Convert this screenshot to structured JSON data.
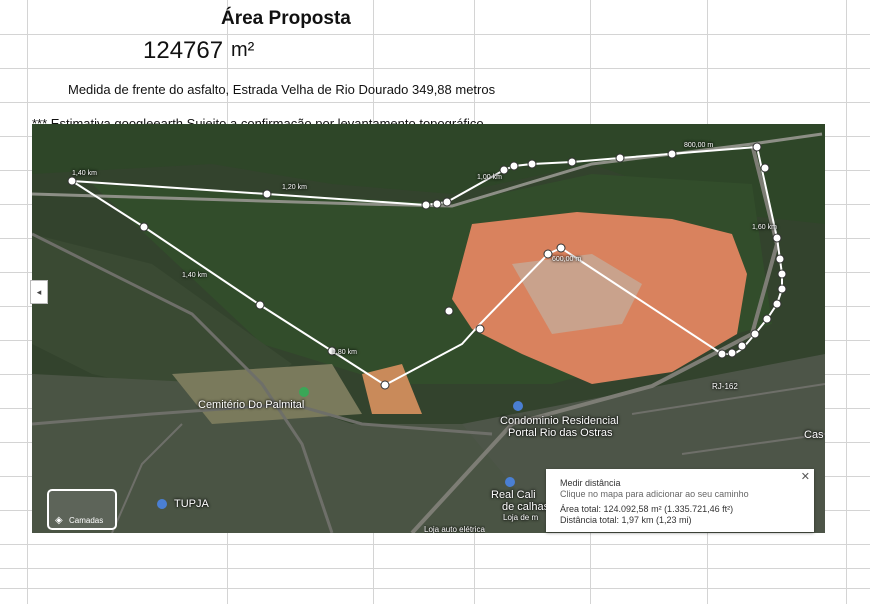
{
  "sheet": {
    "title": "Área Proposta",
    "area_value": "124767",
    "area_unit": "m²",
    "front_measure": "Medida de frente do asfalto, Estrada Velha de Rio Dourado 349,88 metros",
    "estimate_note": "*** Estimativa googleearth Sujeito a confirmação por levantamento topográfico"
  },
  "map": {
    "places": {
      "cemetery": "Cemitério Do Palmital",
      "condominium_line1": "Condominio Residencial",
      "condominium_line2": "Portal Rio das Ostras",
      "tupja": "TUPJA",
      "real_line1": "Real Cali",
      "real_line2": "de calhas",
      "real_line3": "Loja de m",
      "bottom_store": "Loja auto elétrica",
      "road": "RJ-162",
      "cas": "Cas"
    },
    "distance_labels": [
      "1,40 km",
      "1,20 km",
      "1,00 km",
      "800,00 m",
      "600,00 m",
      "1,40 km",
      "1,60 km",
      "1,80 km"
    ],
    "layers_button": "Camadas",
    "layers_icon": "layers-icon",
    "measure_panel": {
      "title": "Medir distância",
      "hint": "Clique no mapa para adicionar ao seu caminho",
      "total_area": "Área total: 124.092,58 m² (1.335.721,46 ft²)",
      "total_distance": "Distância total: 1,97 km (1,23 mi)",
      "close": "✕"
    },
    "colors": {
      "clearing": "#d9825e",
      "vegetation": "#2f4a2a",
      "path": "#ffffff"
    }
  }
}
